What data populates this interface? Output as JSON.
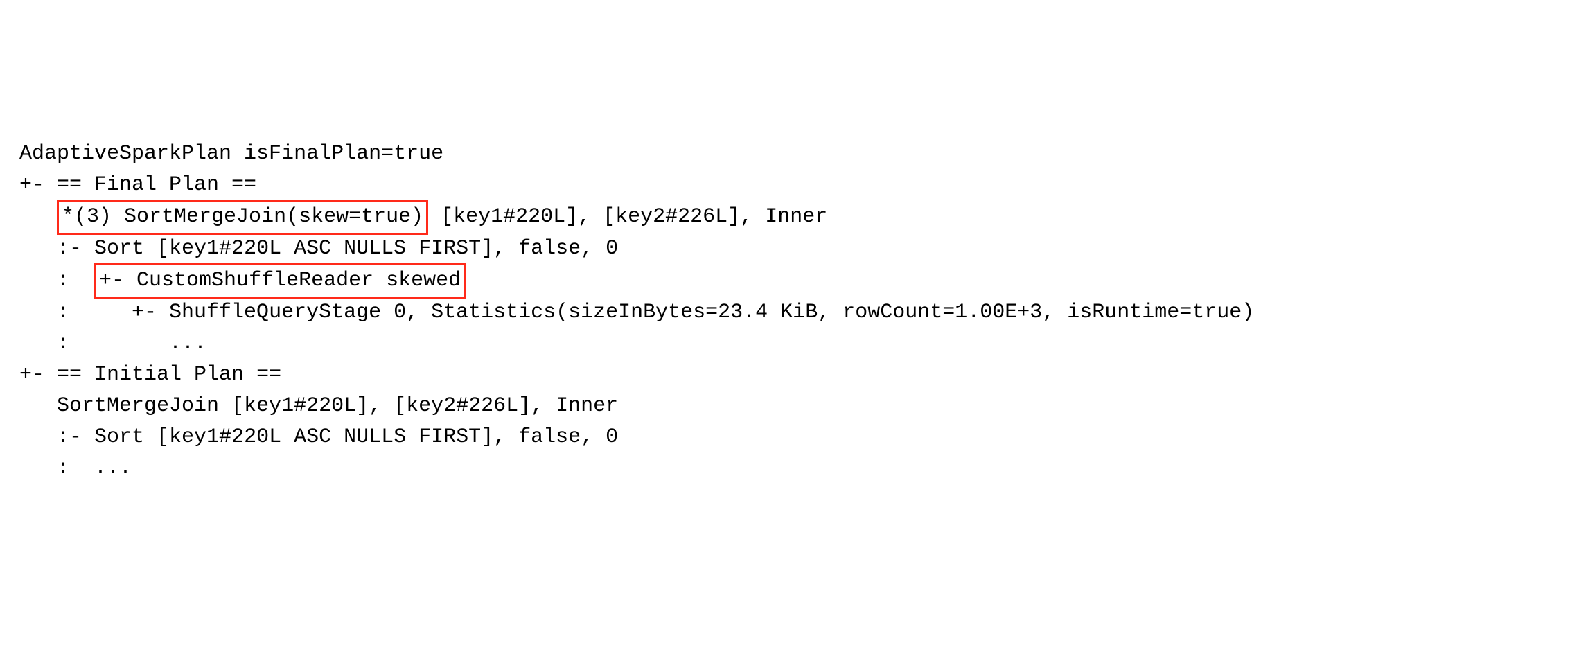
{
  "plan": {
    "lines": [
      {
        "prefix": "",
        "text_before": "AdaptiveSparkPlan isFinalPlan=true",
        "highlight": null,
        "text_after": ""
      },
      {
        "prefix": "+- ",
        "text_before": "== Final Plan ==",
        "highlight": null,
        "text_after": ""
      },
      {
        "prefix": "   ",
        "text_before": "",
        "highlight": "*(3) SortMergeJoin(skew=true)",
        "text_after": " [key1#220L], [key2#226L], Inner"
      },
      {
        "prefix": "   :- ",
        "text_before": "Sort [key1#220L ASC NULLS FIRST], false, 0",
        "highlight": null,
        "text_after": ""
      },
      {
        "prefix": "   :  ",
        "text_before": "",
        "highlight": "+- CustomShuffleReader skewed",
        "text_after": ""
      },
      {
        "prefix": "   :     ",
        "text_before": "+- ShuffleQueryStage 0, Statistics(sizeInBytes=23.4 KiB, rowCount=1.00E+3, isRuntime=true)",
        "highlight": null,
        "text_after": ""
      },
      {
        "prefix": "   :        ",
        "text_before": "...",
        "highlight": null,
        "text_after": ""
      },
      {
        "prefix": "+- ",
        "text_before": "== Initial Plan ==",
        "highlight": null,
        "text_after": ""
      },
      {
        "prefix": "   ",
        "text_before": "SortMergeJoin [key1#220L], [key2#226L], Inner",
        "highlight": null,
        "text_after": ""
      },
      {
        "prefix": "   :- ",
        "text_before": "Sort [key1#220L ASC NULLS FIRST], false, 0",
        "highlight": null,
        "text_after": ""
      },
      {
        "prefix": "   :  ",
        "text_before": "...",
        "highlight": null,
        "text_after": ""
      }
    ]
  },
  "colors": {
    "highlight_border": "#ff2a1a",
    "text": "#000000",
    "background": "#ffffff"
  }
}
